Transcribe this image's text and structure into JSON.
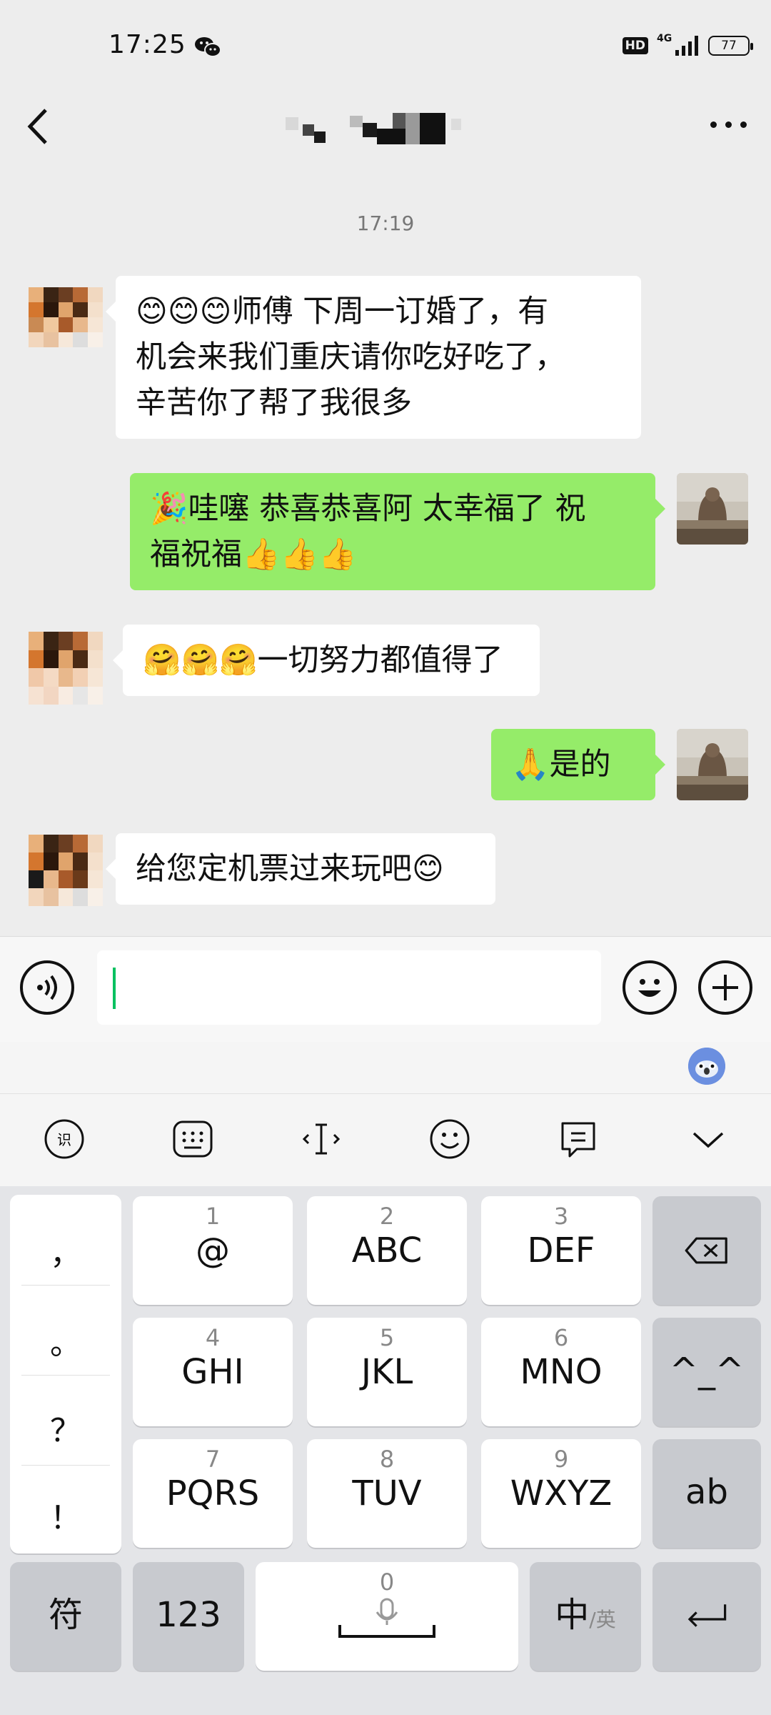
{
  "status_bar": {
    "time": "17:25",
    "network": "4G",
    "hd": "HD",
    "battery": "77"
  },
  "chat": {
    "timestamp": "17:19",
    "messages": [
      {
        "side": "in",
        "lines": [
          "😊😊😊师傅 下周一订婚了，有",
          "机会来我们重庆请你吃好吃了，",
          "辛苦你了帮了我很多"
        ]
      },
      {
        "side": "out",
        "lines": [
          "🎉哇噻  恭喜恭喜阿  太幸福了 祝",
          "福祝福👍👍👍"
        ]
      },
      {
        "side": "in",
        "lines": [
          "🤗🤗🤗一切努力都值得了"
        ]
      },
      {
        "side": "out",
        "lines": [
          "🙏是的"
        ]
      },
      {
        "side": "in",
        "lines": [
          "给您定机票过来玩吧😊"
        ]
      }
    ]
  },
  "input": {
    "value": ""
  },
  "keyboard": {
    "symbols": [
      "，",
      "。",
      "？",
      "！"
    ],
    "keys": [
      {
        "num": "1",
        "label": "@"
      },
      {
        "num": "2",
        "label": "ABC"
      },
      {
        "num": "3",
        "label": "DEF"
      },
      {
        "num": "4",
        "label": "GHI"
      },
      {
        "num": "5",
        "label": "JKL"
      },
      {
        "num": "6",
        "label": "MNO"
      },
      {
        "num": "7",
        "label": "PQRS"
      },
      {
        "num": "8",
        "label": "TUV"
      },
      {
        "num": "9",
        "label": "WXYZ"
      }
    ],
    "emoticon_key": "^_^",
    "case_key": "ab",
    "symbol_key": "符",
    "number_key": "123",
    "space_num": "0",
    "lang_key_main": "中",
    "lang_key_alt": "/英"
  }
}
